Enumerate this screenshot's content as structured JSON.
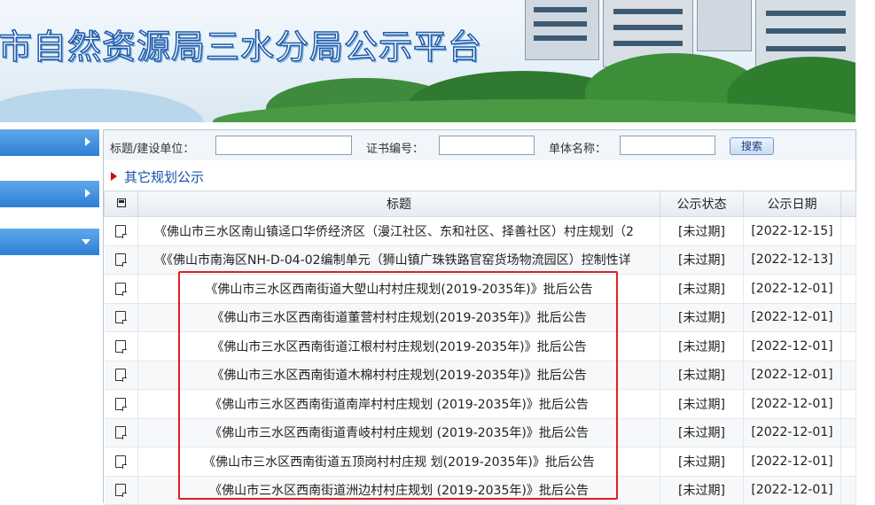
{
  "banner": {
    "title": "市自然资源局三水分局公示平台"
  },
  "search": {
    "title_label": "标题/建设单位：",
    "cert_label": "证书编号：",
    "unit_label": "单体名称：",
    "title_value": "",
    "cert_value": "",
    "unit_value": "",
    "button_label": "搜索"
  },
  "section": {
    "label": "其它规划公示"
  },
  "table": {
    "headers": {
      "title": "标题",
      "status": "公示状态",
      "date": "公示日期"
    },
    "rows": [
      {
        "title": "《佛山市三水区南山镇迳口华侨经济区（漫江社区、东和社区、择善社区）村庄规划（2",
        "status": "[未过期]",
        "date": "[2022-12-15]"
      },
      {
        "title": "《《佛山市南海区NH-D-04-02编制单元（狮山镇广珠铁路官窑货场物流园区）控制性详",
        "status": "[未过期]",
        "date": "[2022-12-13]"
      },
      {
        "title": "《佛山市三水区西南街道大塱山村村庄规划(2019-2035年)》批后公告",
        "status": "[未过期]",
        "date": "[2022-12-01]"
      },
      {
        "title": "《佛山市三水区西南街道董营村村庄规划(2019-2035年)》批后公告",
        "status": "[未过期]",
        "date": "[2022-12-01]"
      },
      {
        "title": "《佛山市三水区西南街道江根村村庄规划(2019-2035年)》批后公告",
        "status": "[未过期]",
        "date": "[2022-12-01]"
      },
      {
        "title": "《佛山市三水区西南街道木棉村村庄规划(2019-2035年)》批后公告",
        "status": "[未过期]",
        "date": "[2022-12-01]"
      },
      {
        "title": "《佛山市三水区西南街道南岸村村庄规划 (2019-2035年)》批后公告",
        "status": "[未过期]",
        "date": "[2022-12-01]"
      },
      {
        "title": "《佛山市三水区西南街道青岐村村庄规划 (2019-2035年)》批后公告",
        "status": "[未过期]",
        "date": "[2022-12-01]"
      },
      {
        "title": "《佛山市三水区西南街道五顶岗村村庄规 划(2019-2035年)》批后公告",
        "status": "[未过期]",
        "date": "[2022-12-01]"
      },
      {
        "title": "《佛山市三水区西南街道洲边村村庄规划 (2019-2035年)》批后公告",
        "status": "[未过期]",
        "date": "[2022-12-01]"
      }
    ]
  },
  "icons": {
    "row": "document-icon",
    "header": "select-all-icon",
    "section": "red-triangle-icon"
  },
  "colors": {
    "accent": "#2d7fd5",
    "link": "#1550b0",
    "highlight": "#e02020"
  }
}
